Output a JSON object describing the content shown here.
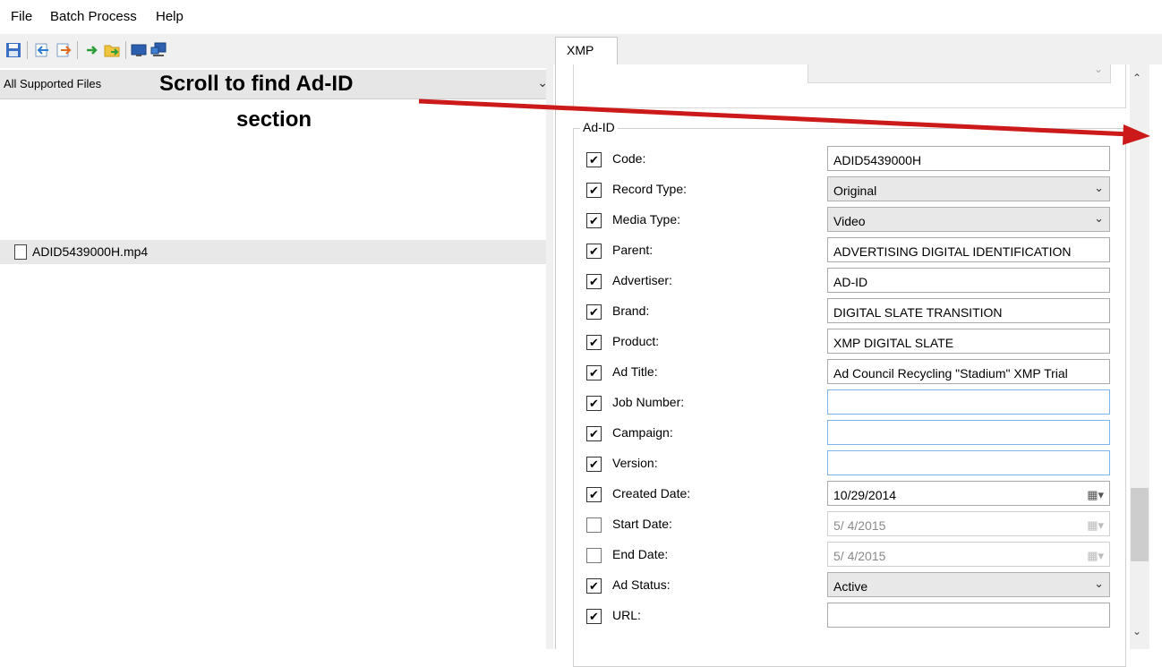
{
  "menu": [
    "File",
    "Batch Process",
    "Help"
  ],
  "filter": {
    "label": "All Supported Files"
  },
  "annotation": {
    "line1": "Scroll to find Ad-ID",
    "line2": "section"
  },
  "file_list": [
    {
      "name": "ADID5439000H.mp4"
    }
  ],
  "tab": {
    "label": "XMP"
  },
  "group": {
    "label": "Ad-ID"
  },
  "rows": [
    {
      "label": "Code:",
      "checked": "✔",
      "value": "ADID5439000H"
    },
    {
      "label": "Record Type:",
      "checked": "✔",
      "value": "Original"
    },
    {
      "label": "Media Type:",
      "checked": "✔",
      "value": "Video"
    },
    {
      "label": "Parent:",
      "checked": "✔",
      "value": "ADVERTISING DIGITAL IDENTIFICATION"
    },
    {
      "label": "Advertiser:",
      "checked": "✔",
      "value": "AD-ID"
    },
    {
      "label": "Brand:",
      "checked": "✔",
      "value": "DIGITAL SLATE TRANSITION"
    },
    {
      "label": "Product:",
      "checked": "✔",
      "value": "XMP DIGITAL SLATE"
    },
    {
      "label": "Ad Title:",
      "checked": "✔",
      "value": "Ad Council Recycling \"Stadium\" XMP Trial"
    },
    {
      "label": "Job Number:",
      "checked": "✔",
      "value": ""
    },
    {
      "label": "Campaign:",
      "checked": "✔",
      "value": ""
    },
    {
      "label": "Version:",
      "checked": "✔",
      "value": ""
    },
    {
      "label": "Created Date:",
      "checked": "✔",
      "value": "10/29/2014"
    },
    {
      "label": "Start Date:",
      "checked": "",
      "value": "5/  4/2015"
    },
    {
      "label": "End Date:",
      "checked": "",
      "value": "5/  4/2015"
    },
    {
      "label": "Ad Status:",
      "checked": "✔",
      "value": "Active"
    },
    {
      "label": "URL:",
      "checked": "✔",
      "value": ""
    }
  ],
  "colors": {
    "annotation_arrow": "#cc1a1a",
    "field_focus_border": "#7eb4ea"
  }
}
